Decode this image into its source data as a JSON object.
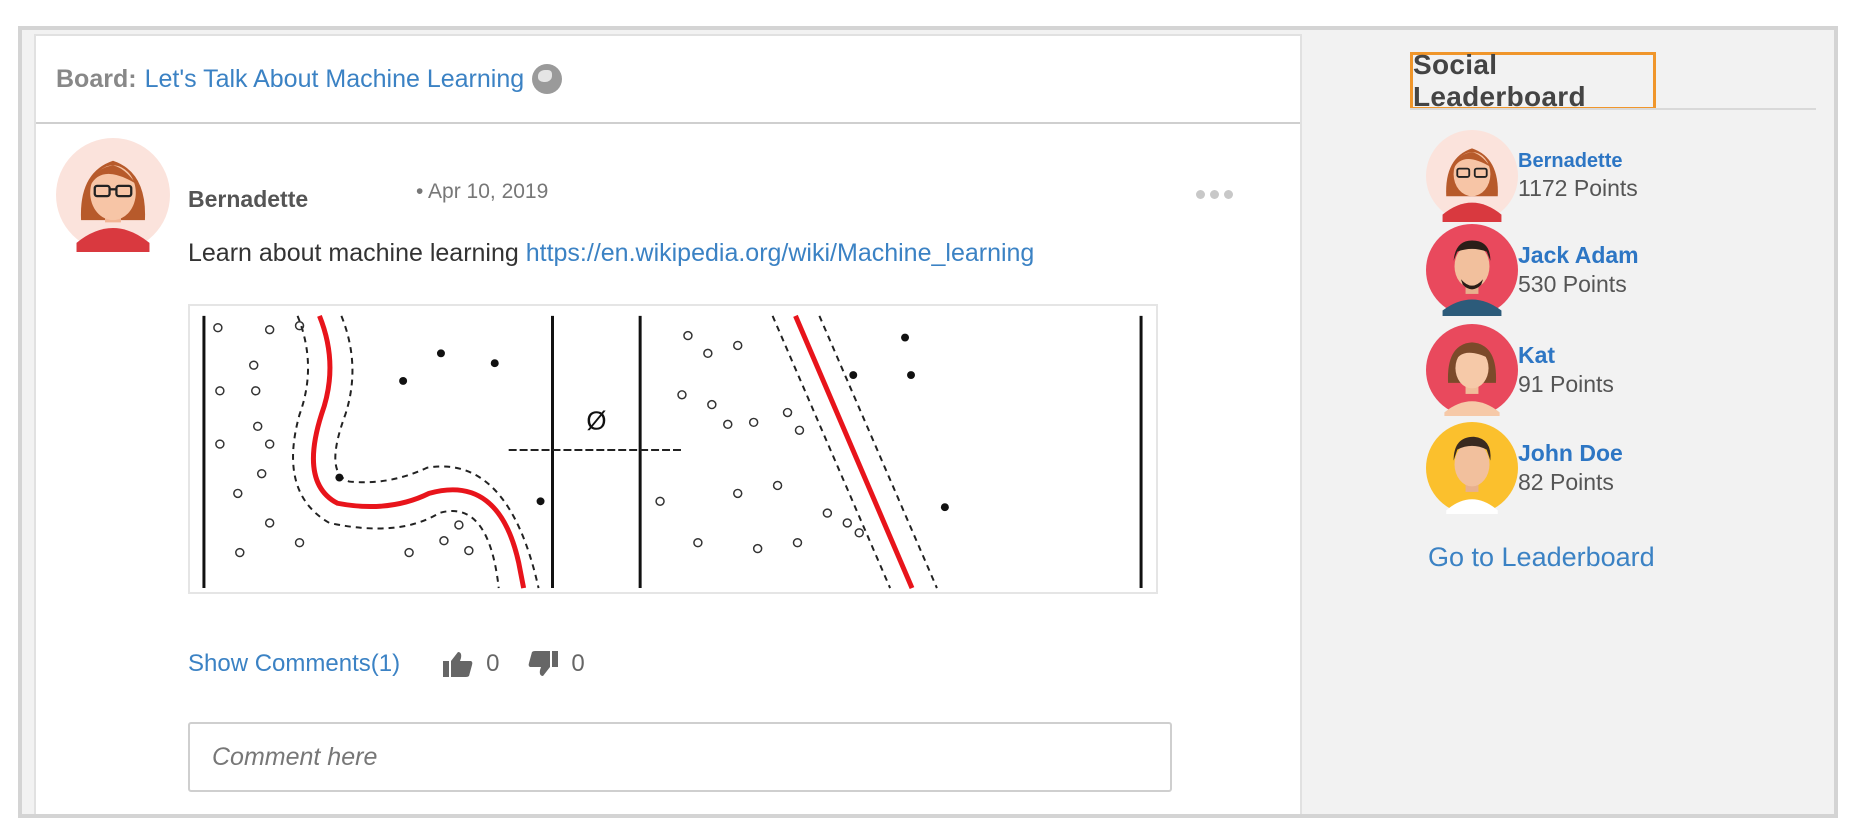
{
  "board": {
    "label": "Board:",
    "title": "Let's Talk About Machine Learning",
    "icon": "globe-icon"
  },
  "post": {
    "author": "Bernadette",
    "date": "• Apr 10, 2019",
    "text": "Learn about machine learning ",
    "link": "https://en.wikipedia.org/wiki/Machine_learning",
    "image_label": "Ø",
    "show_comments": "Show Comments(1)",
    "likes": "0",
    "dislikes": "0",
    "comment_placeholder": "Comment here"
  },
  "leaderboard": {
    "title": "Social Leaderboard",
    "users": [
      {
        "name": "Bernadette",
        "points": "1172 Points"
      },
      {
        "name": "Jack Adam",
        "points": "530 Points"
      },
      {
        "name": "Kat",
        "points": "91 Points"
      },
      {
        "name": "John Doe",
        "points": "82 Points"
      }
    ],
    "go_link": "Go to Leaderboard"
  },
  "colors": {
    "link": "#3b82c4",
    "highlight": "#f0962b",
    "svm_boundary": "#e8141b"
  }
}
